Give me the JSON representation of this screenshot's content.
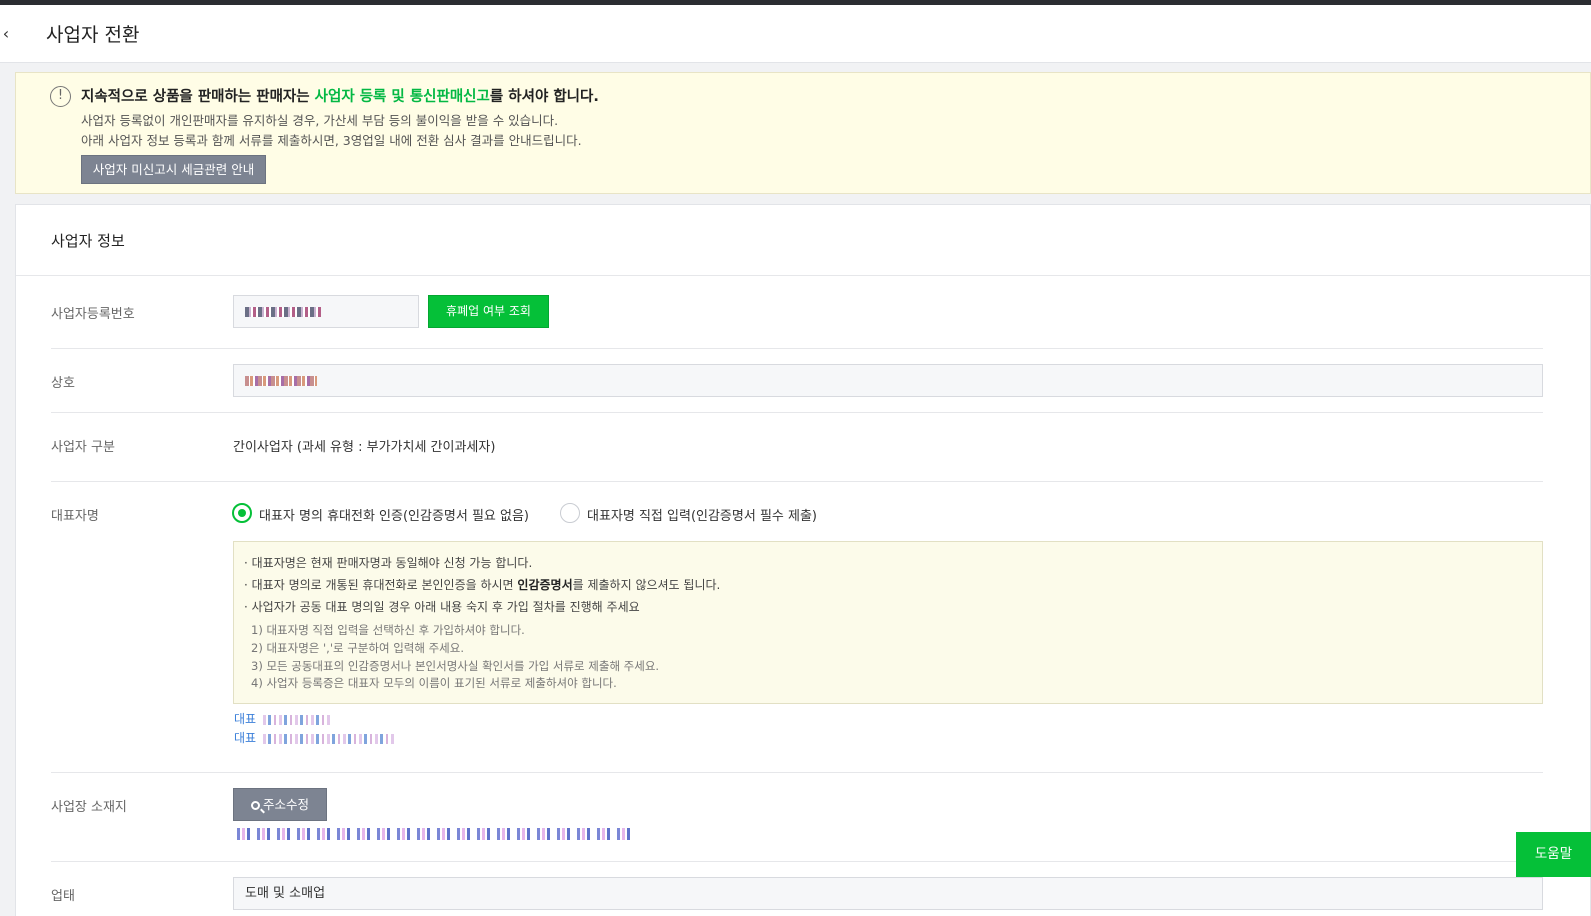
{
  "header": {
    "back_icon": "chevron-left-icon",
    "title": "사업자 전환"
  },
  "notice": {
    "icon": "exclamation-circle-icon",
    "headline_before": "지속적으로 상품을 판매하는 판매자는 ",
    "headline_highlight": "사업자 등록 및 통신판매신고",
    "headline_after": "를 하셔야 합니다.",
    "line1": "사업자 등록없이 개인판매자를 유지하실 경우, 가산세 부담 등의 불이익을 받을 수 있습니다.",
    "line2": "아래 사업자 정보 등록과 함께 서류를 제출하시면, 3영업일 내에 전환 심사 결과를 안내드립니다.",
    "tax_button": "사업자 미신고시 세금관련 안내",
    "highlight_color": "#03b843"
  },
  "business_info": {
    "section_title": "사업자 정보",
    "registration_number": {
      "label": "사업자등록번호",
      "check_button": "휴폐업 여부 조회"
    },
    "company_name": {
      "label": "상호"
    },
    "business_type": {
      "label": "사업자 구분",
      "value": "간이사업자 (과세 유형 : 부가가치세 간이과세자)"
    },
    "representative": {
      "label": "대표자명",
      "options": [
        {
          "label": "대표자 명의 휴대전화 인증(인감증명서 필요 없음)",
          "selected": true
        },
        {
          "label": "대표자명 직접 입력(인감증명서 필수 제출)",
          "selected": false
        }
      ],
      "guide": {
        "bullet1": "· 대표자명은 현재 판매자명과 동일해야 신청 가능 합니다.",
        "bullet2_before": "· 대표자 명의로 개통된 휴대전화로 본인인증을 하시면 ",
        "bullet2_bold": "인감증명서",
        "bullet2_after": "를 제출하지 않으셔도 됩니다.",
        "bullet3": "· 사업자가 공동 대표 명의일 경우 아래 내용 숙지 후 가입 절차를 진행해 주세요",
        "steps": [
          "1) 대표자명 직접 입력을 선택하신 후 가입하셔야 합니다.",
          "2) 대표자명은 ','로 구분하여 입력해 주세요.",
          "3) 모든 공동대표의 인감증명서나 본인서명사실 확인서를 가입 서류로 제출해 주세요.",
          "4) 사업자 등록증은 대표자 모두의 이름이 표기된 서류로 제출하셔야 합니다."
        ]
      },
      "rep_prefix_1": "대표",
      "rep_prefix_2": "대표"
    },
    "address": {
      "label": "사업장 소재지",
      "button": "주소수정",
      "button_icon": "search-icon"
    },
    "industry": {
      "label": "업태",
      "value": "도매 및 소매업"
    }
  },
  "help_button": "도움말",
  "accent_color": "#05c038"
}
